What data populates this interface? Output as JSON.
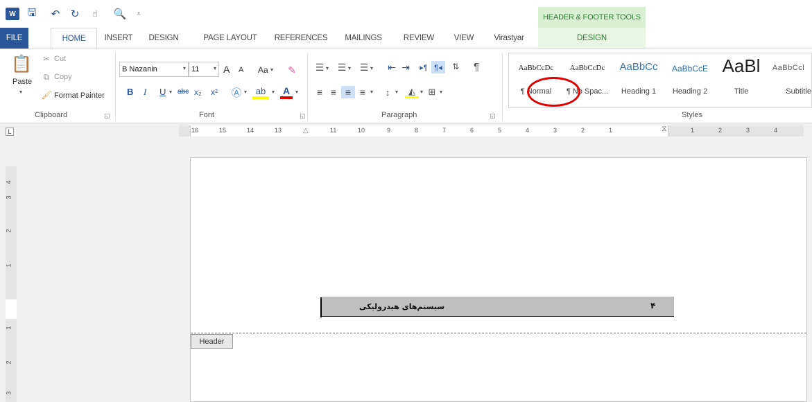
{
  "qat": {
    "word_icon": "W",
    "save_glyph": "🖫",
    "undo_glyph": "↶",
    "redo_glyph": "↻",
    "touch_glyph": "☝",
    "preview_glyph": "🔍",
    "customize_glyph": "⩡"
  },
  "contextual": {
    "header": "HEADER & FOOTER TOOLS",
    "tab": "DESIGN"
  },
  "tabs": [
    "FILE",
    "HOME",
    "INSERT",
    "DESIGN",
    "PAGE LAYOUT",
    "REFERENCES",
    "MAILINGS",
    "REVIEW",
    "VIEW",
    "Virastyar"
  ],
  "clipboard": {
    "paste": "Paste",
    "cut": "Cut",
    "copy": "Copy",
    "format_painter": "Format Painter",
    "label": "Clipboard"
  },
  "font": {
    "name": "B Nazanin",
    "size": "11",
    "grow": "A",
    "shrink": "A",
    "change_case": "Aa",
    "bold": "B",
    "italic": "I",
    "underline": "U",
    "strikethrough": "abc",
    "subscript": "x₂",
    "superscript": "x²",
    "label": "Font"
  },
  "paragraph": {
    "label": "Paragraph"
  },
  "styles": {
    "label": "Styles",
    "items": [
      {
        "sample": "AaBbCcDc",
        "name": "¶ Normal"
      },
      {
        "sample": "AaBbCcDc",
        "name": "¶ No Spac..."
      },
      {
        "sample": "AaBbCc",
        "name": "Heading 1"
      },
      {
        "sample": "AaBbCcE",
        "name": "Heading 2"
      },
      {
        "sample": "AaBl",
        "name": "Title"
      },
      {
        "sample": "AaBbCcl",
        "name": "Subtitle"
      }
    ]
  },
  "ruler": {
    "selector": "L",
    "numbers": [
      "16",
      "15",
      "14",
      "13",
      "11",
      "10",
      "9",
      "8",
      "7",
      "6",
      "5",
      "4",
      "3",
      "2",
      "1",
      "1",
      "2",
      "3",
      "4"
    ],
    "vertical_numbers": [
      "4",
      "3",
      "2",
      "1",
      "1",
      "2",
      "3"
    ]
  },
  "document": {
    "header_title": "سیستم‌های هیدرولیکی",
    "page_number": "۴",
    "header_tag": "Header"
  },
  "colors": {
    "accent": "#2b579a",
    "contextual": "#2e7d32",
    "annotation": "#e00000"
  }
}
